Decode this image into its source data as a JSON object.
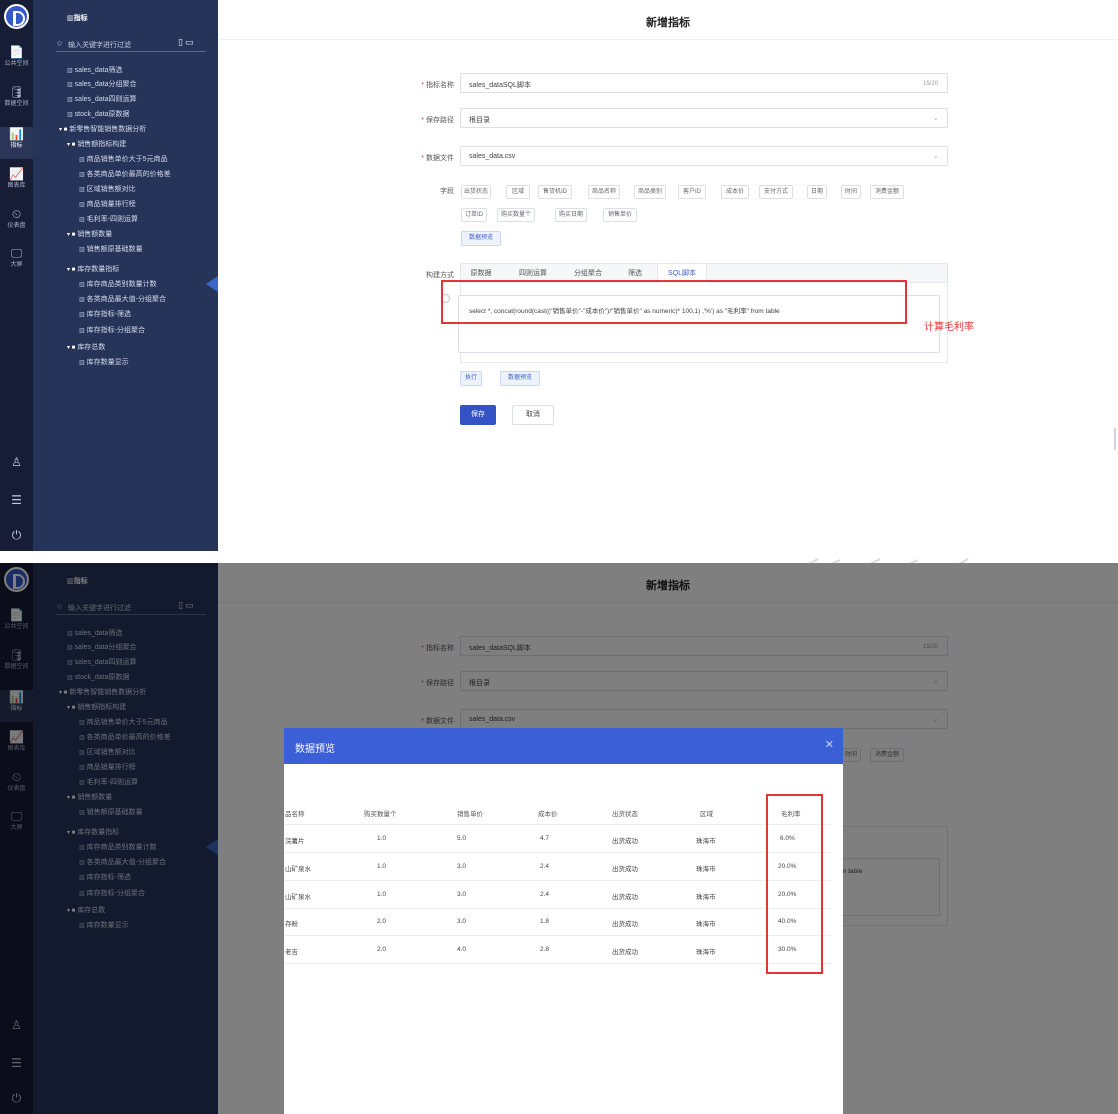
{
  "rail": {
    "items": [
      {
        "icon": "📄",
        "label": "公共空间"
      },
      {
        "icon": "🛢",
        "label": "数据空间"
      },
      {
        "icon": "📊",
        "label": "指标"
      },
      {
        "icon": "📈",
        "label": "图表库"
      },
      {
        "icon": "⏲",
        "label": "仪表盘"
      },
      {
        "icon": "🖵",
        "label": "大屏"
      }
    ],
    "bottom_icons": [
      "user-icon",
      "sliders-icon",
      "power-icon"
    ]
  },
  "tree": {
    "title": "指标",
    "search_placeholder": "输入关键字进行过滤",
    "items": [
      {
        "label": "sales_data筛选",
        "folder": false
      },
      {
        "label": "sales_data分组聚合",
        "folder": false
      },
      {
        "label": "sales_data四则运算",
        "folder": false
      },
      {
        "label": "stock_data原数据",
        "folder": false
      },
      {
        "label": "新零售智能销售数据分析",
        "folder": true
      },
      {
        "label": "销售额指标构建",
        "folder": true
      },
      {
        "label": "商品销售单价大于5元商品",
        "folder": false
      },
      {
        "label": "各类商品单价最高的价格差",
        "folder": false
      },
      {
        "label": "区域销售额对比",
        "folder": false
      },
      {
        "label": "商品销量排行榜",
        "folder": false
      },
      {
        "label": "毛利率-四则运算",
        "folder": false
      },
      {
        "label": "销售额数量",
        "folder": true
      },
      {
        "label": "销售额原基础数量",
        "folder": false
      },
      {
        "label": "库存数量指标",
        "folder": true
      },
      {
        "label": "库存商品类别数量计数",
        "folder": false
      },
      {
        "label": "各类商品最大值-分组聚合",
        "folder": false
      },
      {
        "label": "库存指标-筛选",
        "folder": false
      },
      {
        "label": "库存指标-分组聚合",
        "folder": false
      },
      {
        "label": "库存总数",
        "folder": true
      },
      {
        "label": "库存数量显示",
        "folder": false
      }
    ]
  },
  "form": {
    "page_title": "新增指标",
    "name_label": "指标名称",
    "name_value": "sales_dataSQL脚本",
    "name_count": "15/20",
    "path_label": "保存路径",
    "path_value": "根目录",
    "file_label": "数据文件",
    "file_value": "sales_data.csv",
    "fields_label": "字段",
    "fields": [
      "出货状态",
      "区域",
      "售货机ID",
      "商品名称",
      "商品类别",
      "客户ID",
      "成本价",
      "支付方式",
      "日期",
      "时间",
      "消费金额",
      "订单ID",
      "购买数量个",
      "购买日期",
      "销售单价"
    ],
    "preview_btn": "数据预览",
    "build_label": "构建方式",
    "tabs": [
      "原数据",
      "四则运算",
      "分组聚合",
      "筛选",
      "SQL脚本"
    ],
    "active_tab": "SQL脚本",
    "sql": "select *,  concat(round(cast((\"销售单价\"-\"成本价\")/\"销售单价\" as numeric)* 100,1) ,'%') as \"毛利率\" from table",
    "sql_partial": "m table",
    "run_btn": "执行",
    "preview_btn2": "数据预览",
    "save_btn": "保存",
    "cancel_btn": "取消",
    "annotation": "计算毛利率"
  },
  "modal": {
    "title": "数据预览",
    "columns": [
      "品名称",
      "购买数量个",
      "销售单价",
      "成本价",
      "出货状态",
      "区域",
      "毛利率"
    ],
    "rows": [
      [
        "浣薯片",
        "1.0",
        "5.0",
        "4.7",
        "出货成功",
        "珠海市",
        "6.0%"
      ],
      [
        "山矿泉水",
        "1.0",
        "3.0",
        "2.4",
        "出货成功",
        "珠海市",
        "20.0%"
      ],
      [
        "山矿泉水",
        "1.0",
        "3.0",
        "2.4",
        "出货成功",
        "珠海市",
        "20.0%"
      ],
      [
        "存粉",
        "2.0",
        "3.0",
        "1.8",
        "出货成功",
        "珠海市",
        "40.0%"
      ],
      [
        "老吉",
        "2.0",
        "4.0",
        "2.8",
        "出货成功",
        "珠海市",
        "30.0%"
      ]
    ],
    "partial_tags": [
      "时间",
      "消费金额"
    ]
  },
  "colors": {
    "rail_bg": "#161d34",
    "tree_bg": "#27345a",
    "primary": "#3451c6",
    "modal_header": "#3a5fd6",
    "annotation_red": "#e23535"
  }
}
